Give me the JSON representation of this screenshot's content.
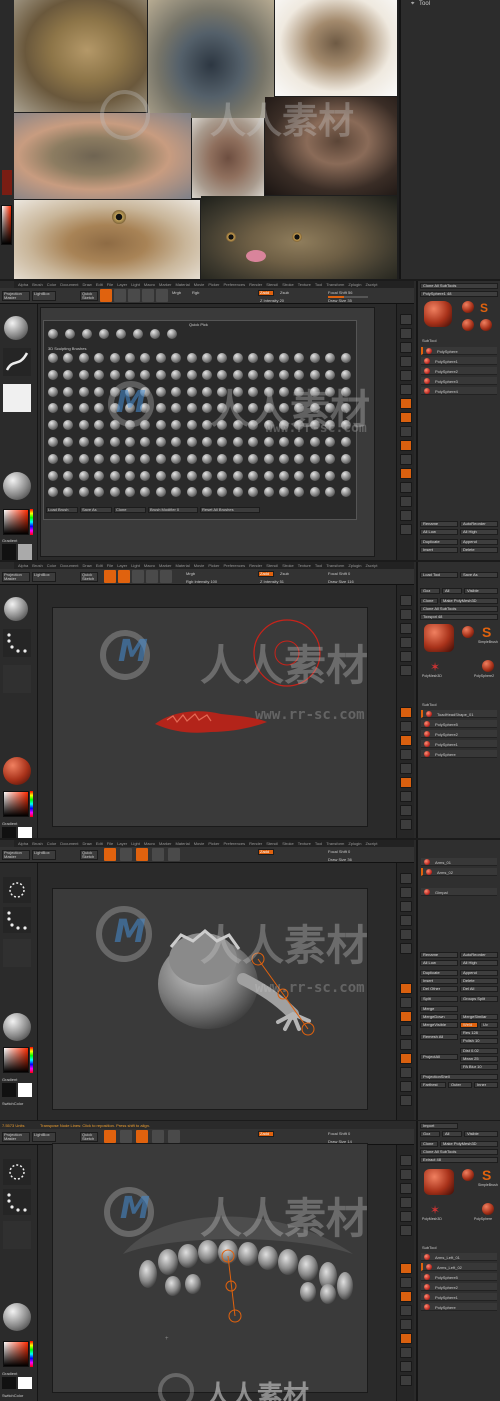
{
  "top_window": {
    "title": "Tool"
  },
  "menu": [
    "Alpha",
    "Brush",
    "Color",
    "Document",
    "Draw",
    "Edit",
    "File",
    "Layer",
    "Light",
    "Macro",
    "Marker",
    "Material",
    "Movie",
    "Picker",
    "Preferences",
    "Render",
    "Stencil",
    "Stroke",
    "Texture",
    "Tool",
    "Transform",
    "Zplugin",
    "Zscript"
  ],
  "shared": {
    "projection_master": "Projection Master",
    "lightbox": "LightBox",
    "quick_sketch": "Quick Sketch",
    "edit": "Edit",
    "draw": "Draw",
    "move": "Move",
    "scale": "Scale",
    "rotate": "Rotate",
    "mrgb": "Mrgb",
    "rgb": "Rgb",
    "m": "M",
    "zadd": "Zadd",
    "zsub": "Zsub",
    "zcut": "Zcut",
    "focal_shift": "Focal Shift 0",
    "draw_size": "Draw Size 35",
    "z_intensity": "Z Intensity 25",
    "rgb_intensity": "Rgb Intensity 100",
    "gradient": "Gradient",
    "switch_color": "SwitchColor",
    "alternate": "Alternate"
  },
  "panel2": {
    "quick_pick": "Quick Pick",
    "sculpting_brushes": "3D Sculpting Brushes",
    "quick_items": [
      "Clay",
      "ClayBuild",
      "Standard",
      "Move",
      "Smooth",
      "Inflat",
      "DamStandard",
      "TrimDynamic"
    ],
    "bottom_buttons": [
      "Load Brush",
      "Save As",
      "Clone",
      "Brush Modifier 0",
      "Reset All Brushes"
    ],
    "focal_shift": "Focal Shift 56",
    "draw_size": "Draw Size 35",
    "z_intensity": "Z Intensity 20",
    "tool_top": [
      "Clone All SubTools",
      "PolySphere1 48"
    ],
    "subtool_header": "SubTool",
    "subtools": [
      "PolySphere",
      "PolySphere1",
      "PolySphere2",
      "PolySphere3",
      "PolySphere4"
    ],
    "tool_buttons": [
      "Rename",
      "AutoReorder",
      "All Low",
      "All High",
      "Duplicate",
      "Append",
      "Insert",
      "Delete"
    ]
  },
  "panel3": {
    "focal_shift": "Focal Shift 0",
    "draw_size": "Draw Size 116",
    "z_intensity": "Z Intensity 51",
    "tool_top": [
      "Load Tool",
      "Save As",
      "Goz",
      "All",
      "Visible",
      "Clone",
      "Make PolyMesh3D",
      "Clone All SubTools",
      "Toxspot 48"
    ],
    "subtool_header": "SubTool",
    "subtools": [
      "ToadHeadShape_01",
      "PolySphere5",
      "PolySphere2",
      "PolySphere1",
      "PolySphere"
    ],
    "tool_icons": [
      "Toxspot",
      "SimpleBrush",
      "PolyMesh3D",
      "PolySphere2"
    ]
  },
  "panel4": {
    "focal_shift": "Focal Shift 0",
    "draw_size": "Draw Size 36",
    "tool_buttons": [
      "Rename",
      "AutoReorder",
      "All Low",
      "All High",
      "Duplicate",
      "Append",
      "Insert",
      "Delete",
      "Del Other",
      "Del All",
      "Split",
      "Groups Split",
      "Merge",
      "MergeDown",
      "MergeSimilar",
      "MergeVisible",
      "Weld",
      "Uv",
      "Remesh All",
      "Res 128",
      "Polish 10",
      "ProjectAll",
      "Dist 0.02",
      "Mean 25",
      "PA Blur 10",
      "ProjectionShell",
      "Farthest",
      "Outer",
      "Inner"
    ],
    "subtools": [
      "Arms_01",
      "Arms_02",
      "Gimpal"
    ]
  },
  "panel5": {
    "status_left": "7.5573 Units",
    "status_msg": "Transpose Node Lines: Click to reposition. Press shift to align.",
    "focal_shift": "Focal Shift 0",
    "draw_size": "Draw Size 14",
    "tool_top": [
      "Import",
      "Goz",
      "All",
      "Visible",
      "Clone",
      "Make PolyMesh3D",
      "Clone All SubTools",
      "Extract 48"
    ],
    "subtool_header": "SubTool",
    "subtools": [
      "Arms_Left_01",
      "Arms_Left_02",
      "PolySphere5",
      "PolySphere2",
      "PolySphere1",
      "PolySphere"
    ],
    "tool_icons": [
      "Extract",
      "SimpleBrush",
      "PolyMesh3D",
      "PolySphere"
    ]
  },
  "panel4_status": {
    "status_msg": "Transpose Node Lines: Click to reposition. Press shift to align."
  },
  "watermark": {
    "cn": "人人素材",
    "url": "www.rr-sc.com",
    "logo_letters": "M"
  },
  "colors": {
    "accent": "#e0620e",
    "panel": "#2a2a2a",
    "canvas": "#3a3a3a",
    "brush_red": "#b3201a"
  }
}
